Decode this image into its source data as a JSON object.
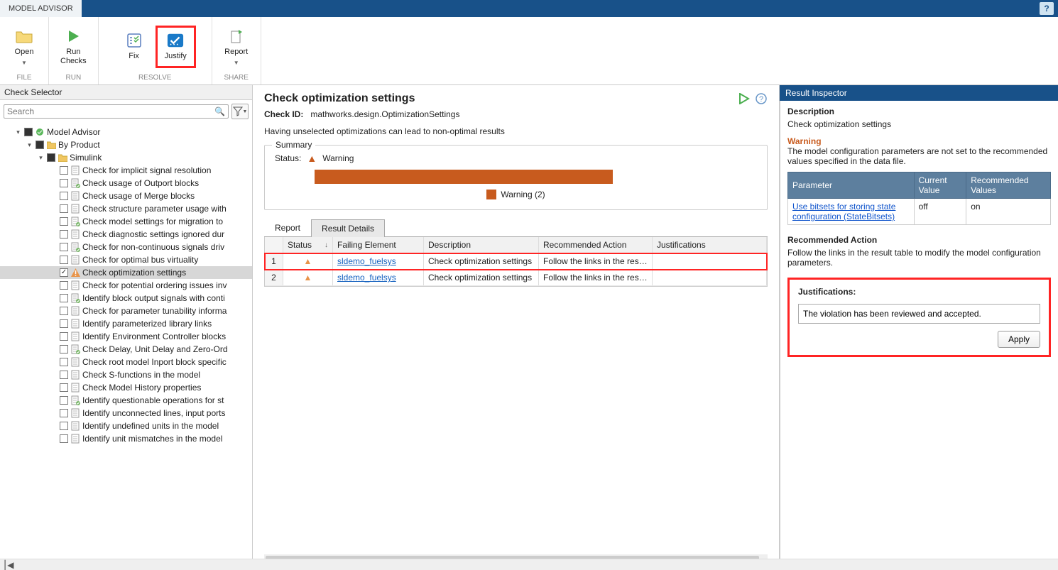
{
  "titlebar": {
    "tab_label": "MODEL ADVISOR"
  },
  "ribbon": {
    "open": "Open",
    "run_checks": "Run\nChecks",
    "fix": "Fix",
    "justify": "Justify",
    "report": "Report",
    "groups": {
      "file": "FILE",
      "run": "RUN",
      "resolve": "RESOLVE",
      "share": "SHARE"
    }
  },
  "left": {
    "panel_title": "Check Selector",
    "search_placeholder": "Search",
    "root": "Model Advisor",
    "by_product": "By Product",
    "simulink": "Simulink",
    "items": [
      "Check for implicit signal resolution",
      "Check usage of Outport blocks",
      "Check usage of Merge blocks",
      "Check structure parameter usage with",
      "Check model settings for migration to",
      "Check diagnostic settings ignored dur",
      "Check for non-continuous signals driv",
      "Check for optimal bus virtuality",
      "Check optimization settings",
      "Check for potential ordering issues inv",
      "Identify block output signals with conti",
      "Check for parameter tunability informa",
      "Identify parameterized library links",
      "Identify Environment Controller blocks",
      "Check Delay, Unit Delay and Zero-Ord",
      "Check root model Inport block specific",
      "Check S-functions in the model",
      "Check Model History properties",
      "Identify questionable operations for st",
      "Identify unconnected lines, input ports",
      "Identify undefined units in the model",
      "Identify unit mismatches in the model"
    ],
    "selected_index": 8
  },
  "center": {
    "title": "Check optimization settings",
    "check_id_label": "Check ID:",
    "check_id": "mathworks.design.OptimizationSettings",
    "description": "Having unselected optimizations can lead to non-optimal results",
    "summary_label": "Summary",
    "status_label": "Status:",
    "status_value": "Warning",
    "legend": "Warning (2)",
    "tabs": {
      "report": "Report",
      "result_details": "Result Details"
    },
    "columns": {
      "status": "Status",
      "failing": "Failing Element",
      "description": "Description",
      "action": "Recommended Action",
      "just": "Justifications"
    },
    "rows": [
      {
        "n": "1",
        "failing": "sldemo_fuelsys",
        "desc": "Check optimization settings",
        "action": "Follow the links in the resu..."
      },
      {
        "n": "2",
        "failing": "sldemo_fuelsys",
        "desc": "Check optimization settings",
        "action": "Follow the links in the resu..."
      }
    ]
  },
  "right": {
    "header": "Result Inspector",
    "desc_label": "Description",
    "desc_text": "Check optimization settings",
    "warn_label": "Warning",
    "warn_text": "The model configuration parameters are not set to the recommended values specified in the data file.",
    "table": {
      "headers": {
        "param": "Parameter",
        "current": "Current Value",
        "recommended": "Recommended Values"
      },
      "row": {
        "param": "Use bitsets for storing state configuration (StateBitsets)",
        "current": "off",
        "recommended": "on"
      }
    },
    "rec_label": "Recommended Action",
    "rec_text": "Follow the links in the result table to modify the model configuration parameters.",
    "just_label": "Justifications:",
    "just_value": "The violation has been reviewed and accepted.",
    "apply": "Apply"
  }
}
